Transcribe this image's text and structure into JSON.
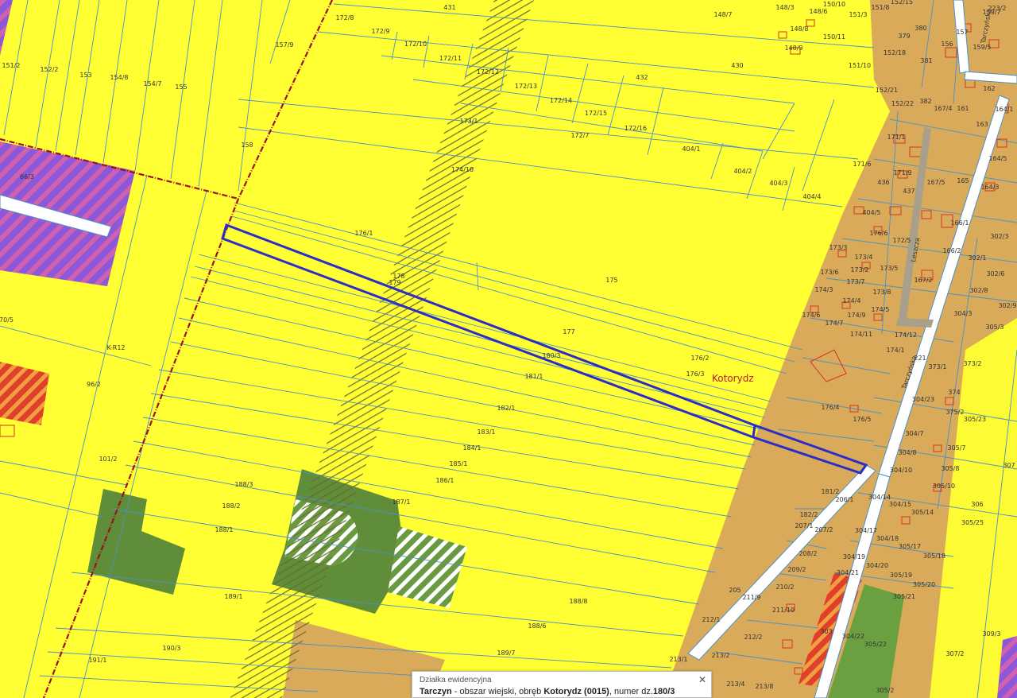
{
  "map": {
    "place_name": "Kotorydz",
    "streets": [
      "Tarczyńska",
      "Leszcza",
      "Tarczyńska"
    ],
    "colors": {
      "agricultural": "#ffff33",
      "village": "#d9aa5a",
      "green": "#5f8d3a",
      "parcel_line": "#4a90c8",
      "selected_parcel": "#2c2cc8",
      "boundary": "#a0101a",
      "pink_hatch": "#c050c0",
      "red_hatch": "#e05030"
    },
    "parcels": [
      "431",
      "172/8",
      "172/9",
      "172/10",
      "172/11",
      "172/12",
      "172/13",
      "172/14",
      "172/15",
      "172/16",
      "172/7",
      "173/1",
      "174/10",
      "148/7",
      "148/3",
      "148/6",
      "148/8",
      "148/9",
      "150/10",
      "150/11",
      "151/3",
      "151/8",
      "151/10",
      "152/15",
      "152/18",
      "152/21",
      "152/22",
      "430",
      "432",
      "404/1",
      "404/2",
      "404/3",
      "404/4",
      "157/9",
      "151/2",
      "152/2",
      "153",
      "154/8",
      "154/7",
      "155",
      "156",
      "158",
      "176/1",
      "178",
      "179",
      "175",
      "177",
      "180/3",
      "181/1",
      "176/2",
      "176/3",
      "182/1",
      "183/1",
      "184/1",
      "185/1",
      "186/1",
      "187/1",
      "188/3",
      "188/2",
      "188/1",
      "189/1",
      "188/8",
      "188/6",
      "189/7",
      "190/3",
      "191/1",
      "96/2",
      "101/2",
      "70/5",
      "66/3",
      "171/6",
      "171/9",
      "436",
      "437",
      "404/5",
      "167/5",
      "165",
      "164/3",
      "166/1",
      "176/6",
      "172/5",
      "166/2",
      "173/3",
      "173/4",
      "173/6",
      "173/2",
      "173/7",
      "173/5",
      "173/8",
      "167/2",
      "174/3",
      "174/4",
      "174/5",
      "174/6",
      "174/7",
      "174/9",
      "174/11",
      "174/12",
      "174/1",
      "176/4",
      "176/5",
      "221",
      "373/1",
      "373/2",
      "374",
      "375/2",
      "304/23",
      "305/23",
      "304/7",
      "304/8",
      "305/7",
      "304/10",
      "305/8",
      "305/10",
      "181/2",
      "206/1",
      "304/14",
      "304/15",
      "305/14",
      "182/2",
      "207/1",
      "207/2",
      "304/17",
      "304/18",
      "305/17",
      "305/25",
      "304/19",
      "305/18",
      "208/2",
      "209/2",
      "304/20",
      "304/21",
      "305/19",
      "305/20",
      "305/21",
      "210/2",
      "211/9",
      "211/10",
      "205",
      "212/1",
      "212/2",
      "213/2",
      "213/1",
      "213/4",
      "213/8",
      "303",
      "304/22",
      "305/22",
      "307/2",
      "309/3",
      "305/2",
      "306",
      "307",
      "302/1",
      "302/3",
      "302/6",
      "302/8",
      "302/9",
      "304/3",
      "305/3",
      "161",
      "163",
      "164/1",
      "164/5",
      "167/4",
      "171/1",
      "380",
      "379",
      "381",
      "382",
      "156",
      "157",
      "159/5",
      "223/2",
      "159/7",
      "162",
      "436",
      "K-R12"
    ]
  },
  "popup": {
    "title": "Działka ewidencyjna",
    "commune": "Tarczyn",
    "commune_type": " - obszar wiejski",
    "separator": ", obręb ",
    "precinct": "Kotorydz (0015)",
    "number_label": ", numer dz.",
    "number": "180/3",
    "close_glyph": "✕"
  }
}
